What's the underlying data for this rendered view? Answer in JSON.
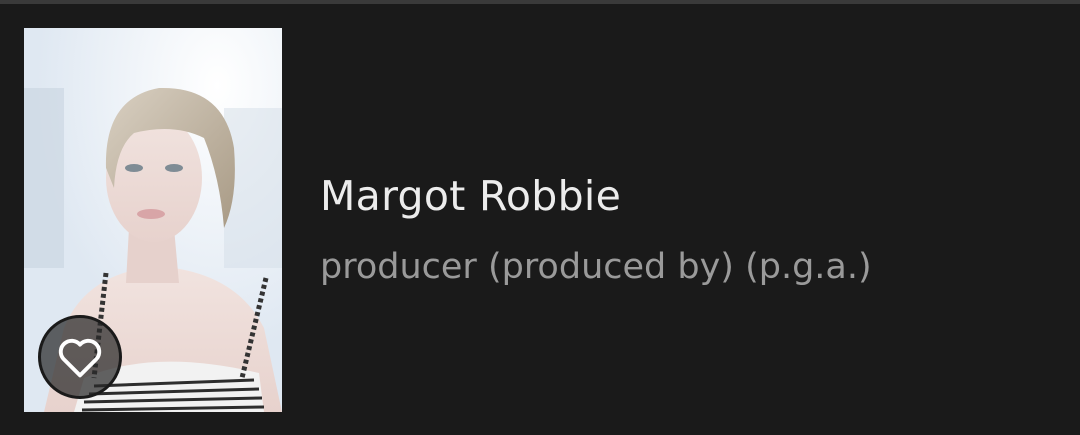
{
  "person": {
    "name": "Margot Robbie",
    "role": "producer (produced by) (p.g.a.)",
    "photo_alt": "Margot Robbie"
  },
  "favorite_button": {
    "icon": "heart-outline-icon",
    "state": "not-favorited"
  },
  "colors": {
    "background": "#1a1a1a",
    "name_text": "#ececec",
    "role_text": "#9a9a9a",
    "top_border": "#3a3a3a"
  }
}
